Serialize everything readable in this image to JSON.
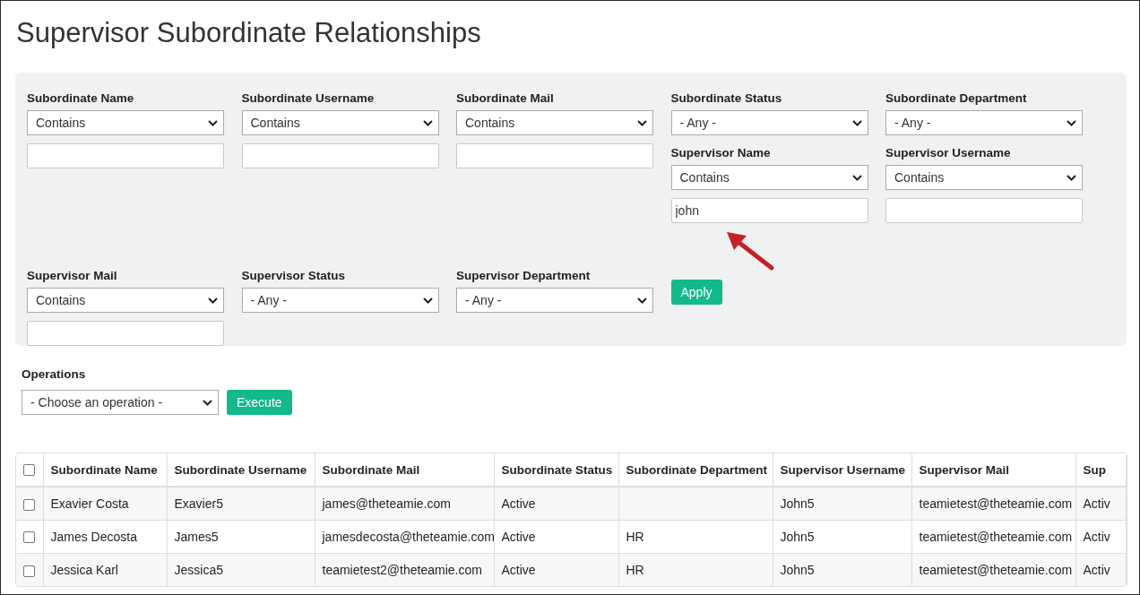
{
  "page_title": "Supervisor Subordinate Relationships",
  "filters": {
    "rows": [
      {
        "columns": [
          [
            {
              "label": "Subordinate Name",
              "kind": "text",
              "operator": "Contains"
            }
          ],
          [
            {
              "label": "Subordinate Username",
              "kind": "text",
              "operator": "Contains"
            }
          ],
          [
            {
              "label": "Subordinate Mail",
              "kind": "text",
              "operator": "Contains"
            }
          ],
          [
            {
              "label": "Subordinate Status",
              "kind": "select",
              "operator": "- Any -"
            },
            {
              "label": "Supervisor Name",
              "kind": "text",
              "operator": "Contains",
              "value": "john"
            }
          ],
          [
            {
              "label": "Subordinate Department",
              "kind": "select",
              "operator": "- Any -"
            },
            {
              "label": "Supervisor Username",
              "kind": "text",
              "operator": "Contains"
            }
          ]
        ]
      },
      {
        "columns": [
          [
            {
              "label": "Supervisor Mail",
              "kind": "text",
              "operator": "Contains"
            }
          ],
          [
            {
              "label": "Supervisor Status",
              "kind": "select",
              "operator": "- Any -"
            }
          ],
          [
            {
              "label": "Supervisor Department",
              "kind": "select",
              "operator": "- Any -"
            }
          ]
        ]
      }
    ],
    "apply_button": "Apply"
  },
  "operations": {
    "label": "Operations",
    "select": "- Choose an operation -",
    "button": "Execute"
  },
  "table": {
    "select_all": {
      "checked": false
    },
    "columns": [
      "Subordinate Name",
      "Subordinate Username",
      "Subordinate Mail",
      "Subordinate Status",
      "Subordinate Department",
      "Supervisor Username",
      "Supervisor Mail",
      "Sup"
    ],
    "rows": [
      {
        "checked": false,
        "cells": [
          "Exavier Costa",
          "Exavier5",
          "james@theteamie.com",
          "Active",
          "",
          "John5",
          "teamietest@theteamie.com",
          "Activ"
        ]
      },
      {
        "checked": false,
        "cells": [
          "James Decosta",
          "James5",
          "jamesdecosta@theteamie.com",
          "Active",
          "HR",
          "John5",
          "teamietest@theteamie.com",
          "Activ"
        ]
      },
      {
        "checked": false,
        "cells": [
          "Jessica Karl",
          "Jessica5",
          "teamietest2@theteamie.com",
          "Active",
          "HR",
          "John5",
          "teamietest@theteamie.com",
          "Activ"
        ]
      }
    ]
  }
}
